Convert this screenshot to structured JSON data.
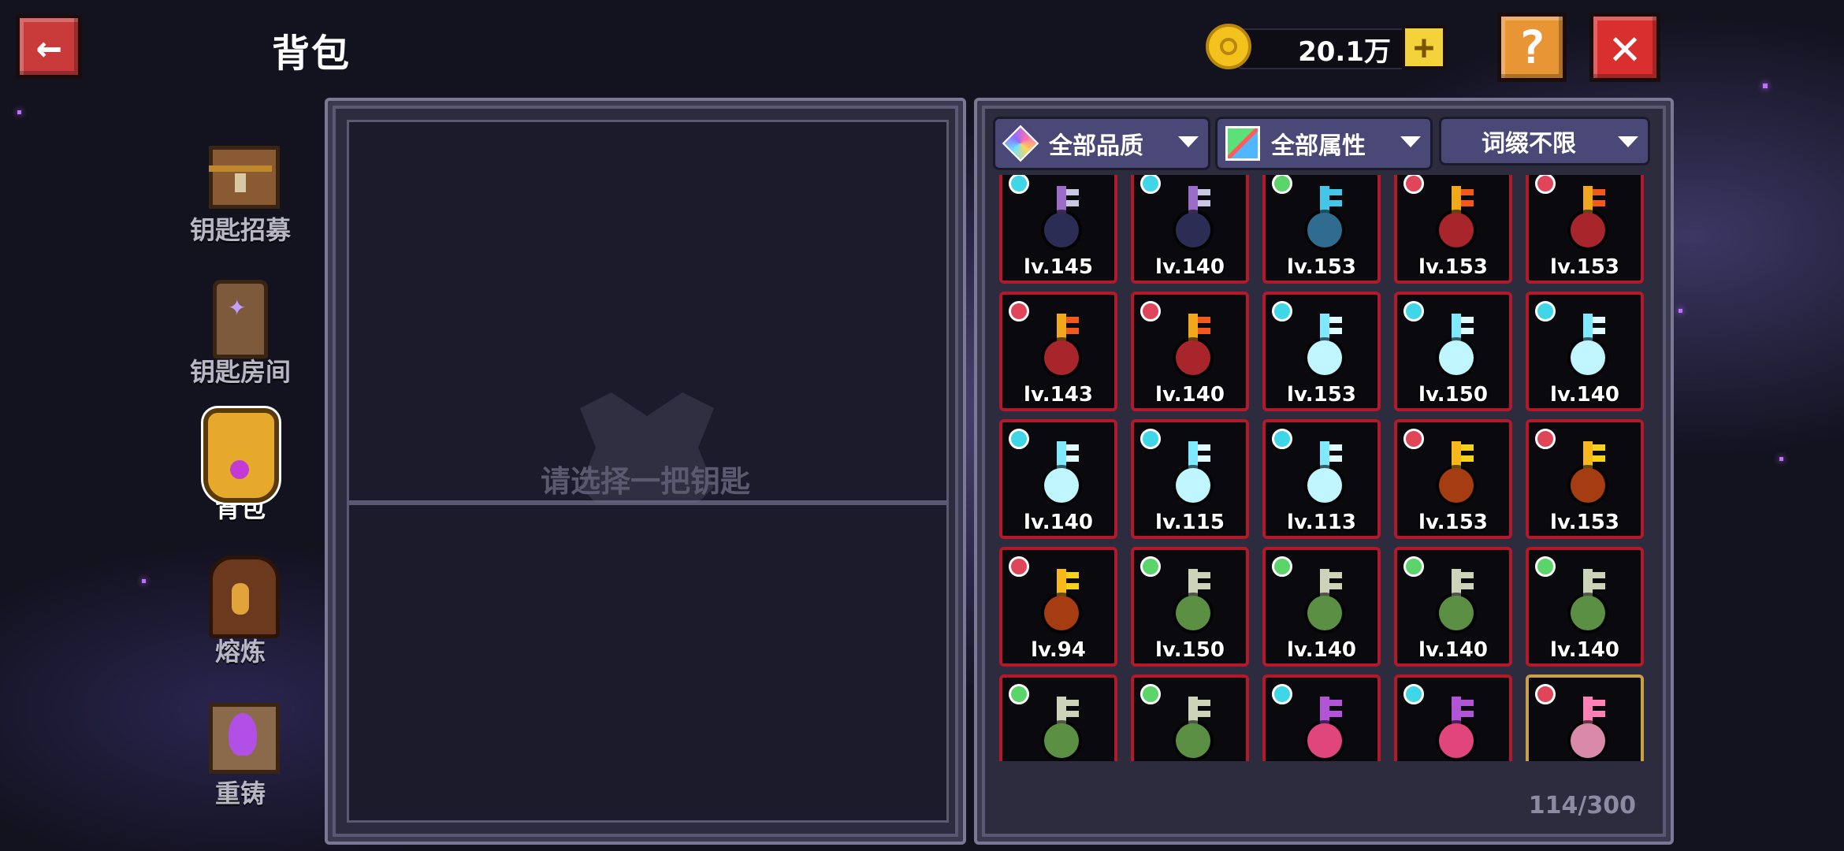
{
  "header": {
    "title": "背包",
    "back_icon": "←",
    "help_icon": "?",
    "close_icon": "✕",
    "currency": {
      "value": "20.1万",
      "add_icon": "+"
    }
  },
  "sidebar": {
    "items": [
      {
        "label": "钥匙招募",
        "icon": "chest-icon"
      },
      {
        "label": "钥匙房间",
        "icon": "scroll-icon"
      },
      {
        "label": "背包",
        "icon": "bag-icon",
        "active": true
      },
      {
        "label": "熔炼",
        "icon": "furnace-icon"
      },
      {
        "label": "重铸",
        "icon": "forge-icon"
      }
    ]
  },
  "detail": {
    "prompt": "请选择一把钥匙"
  },
  "inventory": {
    "filters": {
      "quality": "全部品质",
      "attribute": "全部属性",
      "affix": "词缀不限"
    },
    "capacity": "114/300",
    "items": [
      {
        "level": "lv.145",
        "element": "cyan",
        "type": "void"
      },
      {
        "level": "lv.140",
        "element": "cyan",
        "type": "void"
      },
      {
        "level": "lv.153",
        "element": "green",
        "type": "horn"
      },
      {
        "level": "lv.153",
        "element": "red",
        "type": "flame"
      },
      {
        "level": "lv.153",
        "element": "red",
        "type": "flame"
      },
      {
        "level": "lv.143",
        "element": "red",
        "type": "flame"
      },
      {
        "level": "lv.140",
        "element": "red",
        "type": "flame"
      },
      {
        "level": "lv.153",
        "element": "cyan",
        "type": "ice"
      },
      {
        "level": "lv.150",
        "element": "cyan",
        "type": "ice"
      },
      {
        "level": "lv.140",
        "element": "cyan",
        "type": "ice"
      },
      {
        "level": "lv.140",
        "element": "cyan",
        "type": "ice"
      },
      {
        "level": "lv.115",
        "element": "cyan",
        "type": "ice"
      },
      {
        "level": "lv.113",
        "element": "cyan",
        "type": "ice"
      },
      {
        "level": "lv.153",
        "element": "red",
        "type": "pumpkin"
      },
      {
        "level": "lv.153",
        "element": "red",
        "type": "pumpkin"
      },
      {
        "level": "lv.94",
        "element": "red",
        "type": "pumpkin"
      },
      {
        "level": "lv.150",
        "element": "green",
        "type": "venom"
      },
      {
        "level": "lv.140",
        "element": "green",
        "type": "venom"
      },
      {
        "level": "lv.140",
        "element": "green",
        "type": "venom"
      },
      {
        "level": "lv.140",
        "element": "green",
        "type": "venom"
      },
      {
        "level": "",
        "element": "green",
        "type": "venom"
      },
      {
        "level": "",
        "element": "green",
        "type": "venom"
      },
      {
        "level": "",
        "element": "cyan",
        "type": "heart"
      },
      {
        "level": "",
        "element": "cyan",
        "type": "heart"
      },
      {
        "level": "",
        "element": "red",
        "type": "pink",
        "gold": true
      }
    ]
  },
  "colors": {
    "element_red": "#e0455a",
    "element_cyan": "#3fd6e8",
    "element_green": "#5bd46a",
    "frame_red": "#b3192a",
    "frame_gold": "#c9a04a"
  }
}
